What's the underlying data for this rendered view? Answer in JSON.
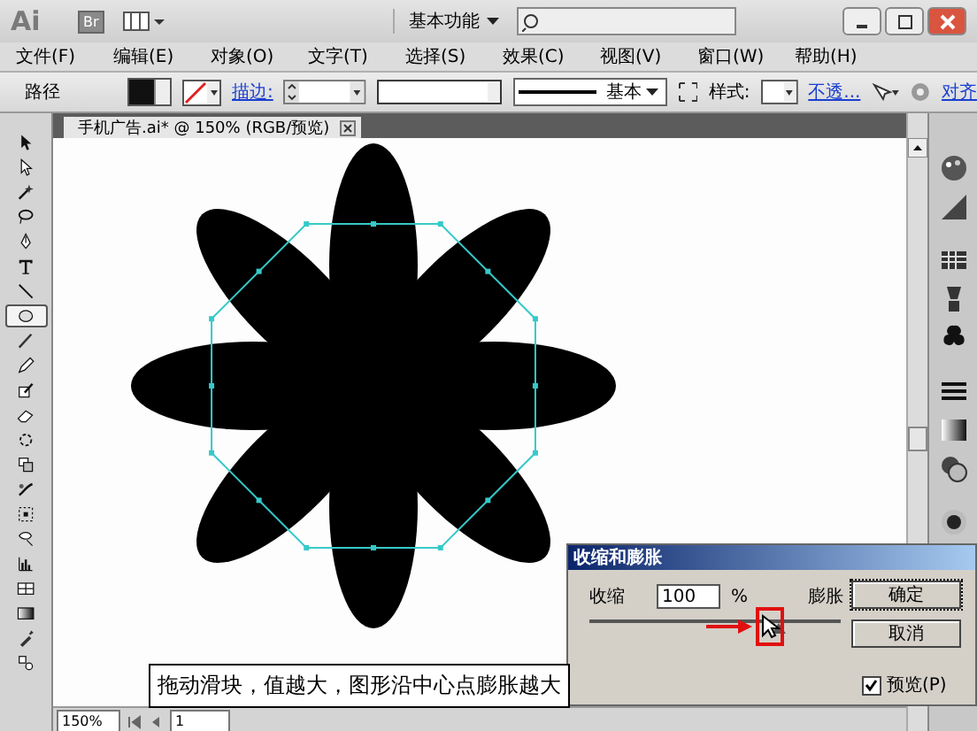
{
  "app": {
    "logo": "Ai",
    "bridge": "Br",
    "workspace": "基本功能"
  },
  "menu": [
    "文件(F)",
    "编辑(E)",
    "对象(O)",
    "文字(T)",
    "选择(S)",
    "效果(C)",
    "视图(V)",
    "窗口(W)",
    "帮助(H)"
  ],
  "control_bar": {
    "object_type": "路径",
    "stroke_label": "描边:",
    "profile": "基本",
    "style_label": "样式:",
    "opacity_link": "不透...",
    "align_link": "对齐"
  },
  "document_tab": {
    "title": "手机广告.ai* @ 150% (RGB/预览)"
  },
  "tools": [
    {
      "selected": false
    },
    {
      "selected": false
    },
    {
      "selected": false
    },
    {
      "selected": false
    },
    {
      "selected": false
    },
    {
      "selected": false
    },
    {
      "selected": false
    },
    {
      "selected": true
    },
    {
      "selected": false
    },
    {
      "selected": false
    },
    {
      "selected": false
    },
    {
      "selected": false
    },
    {
      "selected": false
    },
    {
      "selected": false
    },
    {
      "selected": false
    },
    {
      "selected": false
    },
    {
      "selected": false
    },
    {
      "selected": false
    },
    {
      "selected": false
    },
    {
      "selected": false
    },
    {
      "selected": false
    },
    {
      "selected": false
    }
  ],
  "status_bar": {
    "zoom": "150%",
    "page": "1"
  },
  "dialog": {
    "title": "收缩和膨胀",
    "left_label": "收缩",
    "value": "100",
    "unit": "%",
    "right_label": "膨胀",
    "level": 0.75,
    "buttons": [
      "确定",
      "取消"
    ],
    "preview": {
      "label": "预览(P)",
      "checked": true
    }
  },
  "caption": "拖动滑块，值越大，图形沿中心点膨胀越大"
}
